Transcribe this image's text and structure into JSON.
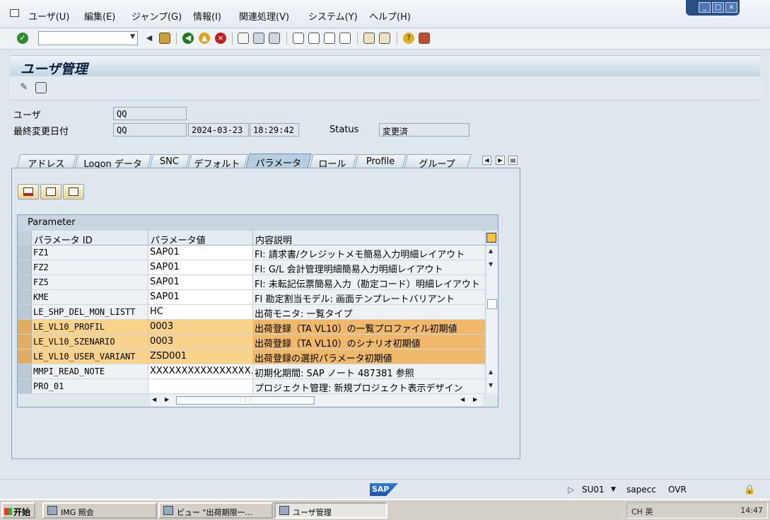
{
  "menu": [
    "ユーザ(U)",
    "編集(E)",
    "ジャンプ(G)",
    "情報(I)",
    "関連処理(V)",
    "システム(Y)",
    "ヘルプ(H)"
  ],
  "window_buttons": [
    "_",
    "□",
    "×"
  ],
  "screen_title": "ユーザ管理",
  "header": {
    "user_label": "ユーザ",
    "user_value": "QQ",
    "changed_label": "最終変更日付",
    "changed_by": "QQ",
    "changed_date": "2024-03-23",
    "changed_time": "18:29:42",
    "status_label": "Status",
    "status_value": "変更済"
  },
  "tabs": [
    "アドレス",
    "Logon データ",
    "SNC",
    "デフォルト",
    "パラメータ",
    "ロール",
    "Profile",
    "グループ"
  ],
  "active_tab": "パラメータ",
  "grid": {
    "title": "Parameter",
    "columns": [
      "パラメータ ID",
      "パラメータ値",
      "内容説明"
    ],
    "rows": [
      {
        "id": "FZ1",
        "value": "SAP01",
        "desc": "FI: 請求書/クレジットメモ簡易入力明細レイアウト",
        "highlight": false
      },
      {
        "id": "FZ2",
        "value": "SAP01",
        "desc": "FI: G/L 会計管理明細簡易入力明細レイアウト",
        "highlight": false
      },
      {
        "id": "FZ5",
        "value": "SAP01",
        "desc": "FI: 未転記伝票簡易入力（勘定コード）明細レイアウト",
        "highlight": false
      },
      {
        "id": "KME",
        "value": "SAP01",
        "desc": "FI 勘定割当モデル: 画面テンプレートバリアント",
        "highlight": false
      },
      {
        "id": "LE_SHP_DEL_MON_LISTT",
        "value": "HC",
        "desc": "出荷モニタ: 一覧タイプ",
        "highlight": false
      },
      {
        "id": "LE_VL10_PROFIL",
        "value": "0003",
        "desc": "出荷登録（TA VL10）の一覧プロファイル初期値",
        "highlight": true
      },
      {
        "id": "LE_VL10_SZENARIO",
        "value": "0003",
        "desc": "出荷登録（TA VL10）のシナリオ初期値",
        "highlight": true
      },
      {
        "id": "LE_VL10_USER_VARIANT",
        "value": "ZSD001",
        "desc": "出荷登録の選択パラメータ初期値",
        "highlight": true
      },
      {
        "id": "MMPI_READ_NOTE",
        "value": "XXXXXXXXXXXXXXXX...",
        "desc": "初期化期間: SAP ノート 487381 参照",
        "highlight": false
      },
      {
        "id": "PRO_01",
        "value": "",
        "desc": "プロジェクト管理: 新規プロジェクト表示デザイン",
        "highlight": false
      }
    ]
  },
  "status": {
    "logo": "SAP",
    "tcode": "SU01",
    "system": "sapecc",
    "mode": "OVR"
  },
  "taskbar": {
    "start": "开始",
    "tasks": [
      "IMG 照会",
      "ビュー \"出荷期限一...",
      "ユーザ管理"
    ],
    "clock": "14:47",
    "tray_text": "CH 英"
  },
  "colors": {
    "highlight": "#f0b96a",
    "sap_blue": "#1a54a8"
  }
}
